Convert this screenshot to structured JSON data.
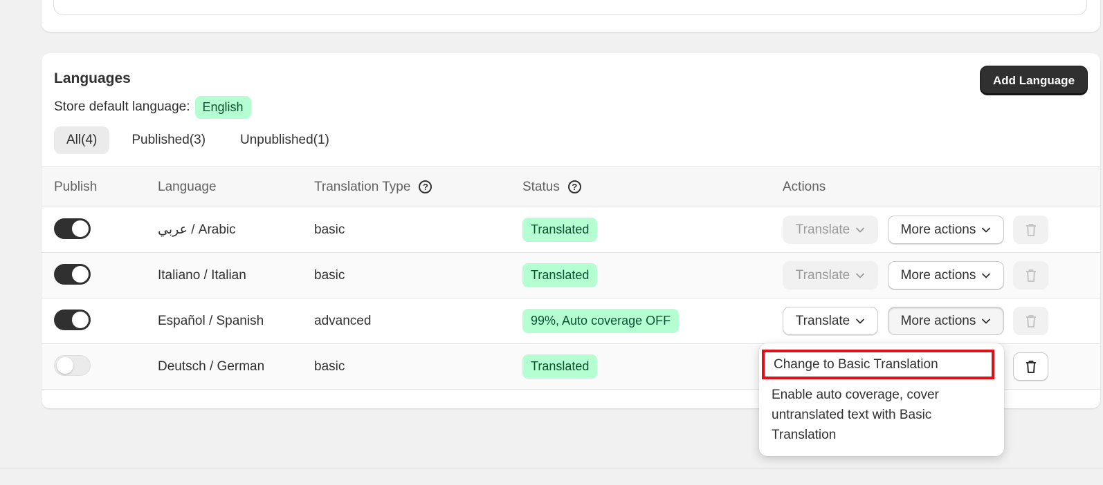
{
  "languages_card": {
    "title": "Languages",
    "add_button": "Add Language",
    "default_label": "Store default language:",
    "default_value": "English"
  },
  "tabs": [
    {
      "label": "All(4)",
      "active": true
    },
    {
      "label": "Published(3)",
      "active": false
    },
    {
      "label": "Unpublished(1)",
      "active": false
    }
  ],
  "table": {
    "headers": {
      "publish": "Publish",
      "language": "Language",
      "translation_type": "Translation Type",
      "status": "Status",
      "actions": "Actions"
    },
    "rows": [
      {
        "published": true,
        "language": "عربي / Arabic",
        "type": "basic",
        "status": "Translated",
        "translate_label": "Translate",
        "translate_enabled": false,
        "more_label": "More actions",
        "delete_enabled": false
      },
      {
        "published": true,
        "language": "Italiano / Italian",
        "type": "basic",
        "status": "Translated",
        "translate_label": "Translate",
        "translate_enabled": false,
        "more_label": "More actions",
        "delete_enabled": false
      },
      {
        "published": true,
        "language": "Español / Spanish",
        "type": "advanced",
        "status": "99%, Auto coverage OFF",
        "translate_label": "Translate",
        "translate_enabled": true,
        "more_label": "More actions",
        "delete_enabled": false
      },
      {
        "published": false,
        "language": "Deutsch / German",
        "type": "basic",
        "status": "Translated",
        "delete_enabled": true
      }
    ]
  },
  "more_actions_menu": {
    "items": [
      "Change to Basic Translation",
      "Enable auto coverage, cover untranslated text with Basic Translation"
    ],
    "highlight_color": "#e0101a"
  },
  "colors": {
    "badge_bg": "#b4fed2",
    "badge_text": "#0c5132",
    "primary_button": "#303030"
  }
}
